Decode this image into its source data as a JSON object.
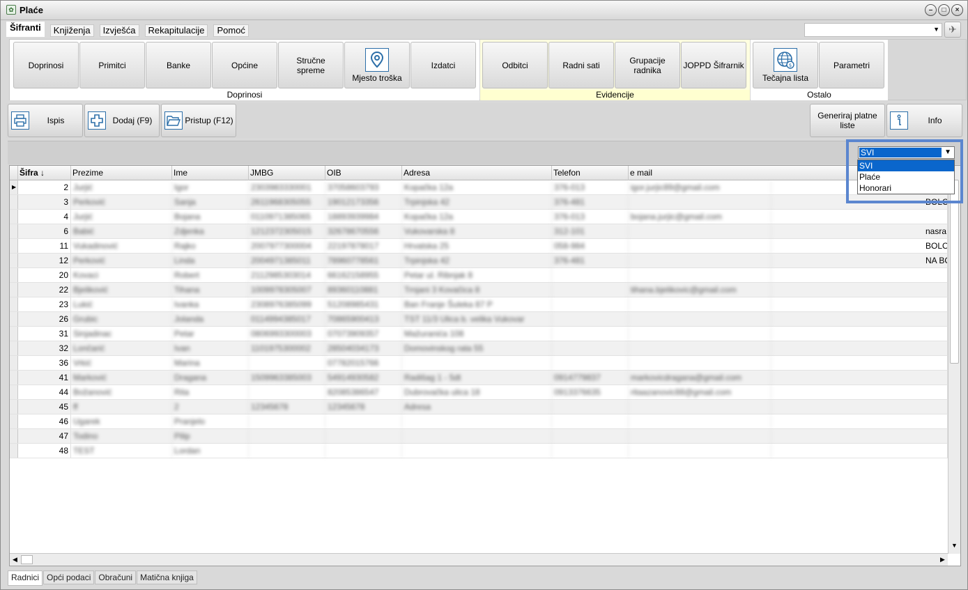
{
  "window": {
    "title": "Plaće"
  },
  "menu": {
    "tabs": [
      "Šifranti",
      "Knjiženja",
      "Izvješća",
      "Rekapitulacije",
      "Pomoć"
    ],
    "active": "Šifranti"
  },
  "ribbon": {
    "groups": [
      {
        "label": "Doprinosi",
        "buttons": [
          "Doprinosi",
          "Primitci",
          "Banke",
          "Općine",
          "Stručne spreme",
          "Mjesto troška",
          "Izdatci"
        ]
      },
      {
        "label": "Evidencije",
        "buttons": [
          "Odbitci",
          "Radni sati",
          "Grupacije radnika",
          "JOPPD Šifrarnik"
        ]
      },
      {
        "label": "Ostalo",
        "buttons": [
          "Tečajna lista",
          "Parametri"
        ]
      }
    ]
  },
  "toolbar": {
    "print": "Ispis",
    "add": "Dodaj (F9)",
    "open": "Pristup (F12)",
    "generate": "Generiraj platne liste",
    "info": "Info"
  },
  "filter": {
    "selected": "SVI",
    "options": [
      "SVI",
      "Plaće",
      "Honorari"
    ]
  },
  "grid": {
    "columns": [
      "Šifra ↓",
      "Prezime",
      "Ime",
      "JMBG",
      "OIB",
      "Adresa",
      "Telefon",
      "e mail"
    ],
    "rows": [
      {
        "sifra": "2",
        "prezime": "Jurjić",
        "ime": "Igor",
        "jmbg": "2303983330001",
        "oib": "37058603793",
        "adresa": "Kopačka 12a",
        "telefon": "376-013",
        "email": "igor.jurjic89@gmail.com",
        "note": ""
      },
      {
        "sifra": "3",
        "prezime": "Perković",
        "ime": "Sanja",
        "jmbg": "2611968305055",
        "oib": "19012173356",
        "adresa": "Trpinjska 42",
        "telefon": "376-481",
        "email": "",
        "note": "BOLO"
      },
      {
        "sifra": "4",
        "prezime": "Jurjić",
        "ime": "Bojana",
        "jmbg": "0110971385065",
        "oib": "18893939984",
        "adresa": "Kopačka 12a",
        "telefon": "376-013",
        "email": "bojana.jurjic@gmail.com",
        "note": ""
      },
      {
        "sifra": "6",
        "prezime": "Babić",
        "ime": "Zdjenka",
        "jmbg": "1212372305015",
        "oib": "32678670556",
        "adresa": "Vukovarska 8",
        "telefon": "312-101",
        "email": "",
        "note": "nasra"
      },
      {
        "sifra": "11",
        "prezime": "Vukadinović",
        "ime": "Rajko",
        "jmbg": "2007977300004",
        "oib": "22197878017",
        "adresa": "Hrvatska 25",
        "telefon": "058-984",
        "email": "",
        "note": "BOLO"
      },
      {
        "sifra": "12",
        "prezime": "Perković",
        "ime": "Linda",
        "jmbg": "2004971385011",
        "oib": "78960778561",
        "adresa": "Trpinjska 42",
        "telefon": "376-481",
        "email": "",
        "note": "NA BC"
      },
      {
        "sifra": "20",
        "prezime": "Kovaci",
        "ime": "Robert",
        "jmbg": "2112985303014",
        "oib": "66162158955",
        "adresa": "Petar ul. Ribnjak 8",
        "telefon": "",
        "email": "",
        "note": ""
      },
      {
        "sifra": "22",
        "prezime": "Bjeliković",
        "ime": "Tihana",
        "jmbg": "1009978305007",
        "oib": "89360110881",
        "adresa": "Trnjani 3 Kovačica 8",
        "telefon": "",
        "email": "tihana.bjelikovic@gmail.com",
        "note": ""
      },
      {
        "sifra": "23",
        "prezime": "Lukić",
        "ime": "Ivanka",
        "jmbg": "2308976385099",
        "oib": "51208985431",
        "adresa": "Ban Franje Šuleka 87 P",
        "telefon": "",
        "email": "",
        "note": ""
      },
      {
        "sifra": "26",
        "prezime": "Grubic",
        "ime": "Jolanda",
        "jmbg": "0114994385017",
        "oib": "70865900413",
        "adresa": "TST 11/3 Ulica b. velika Vukovar",
        "telefon": "",
        "email": "",
        "note": ""
      },
      {
        "sifra": "31",
        "prezime": "Sinjadinac",
        "ime": "Petar",
        "jmbg": "0806993300003",
        "oib": "07073909357",
        "adresa": "Mažuranića 108",
        "telefon": "",
        "email": "",
        "note": ""
      },
      {
        "sifra": "32",
        "prezime": "Lončarić",
        "ime": "Ivan",
        "jmbg": "1101975300002",
        "oib": "28504034173",
        "adresa": "Domovinskog rata 55",
        "telefon": "",
        "email": "",
        "note": ""
      },
      {
        "sifra": "36",
        "prezime": "Vrkić",
        "ime": "Marina",
        "jmbg": "",
        "oib": "07782015766",
        "adresa": "",
        "telefon": "",
        "email": "",
        "note": ""
      },
      {
        "sifra": "41",
        "prezime": "Marković",
        "ime": "Dragana",
        "jmbg": "1509963385003",
        "oib": "54914930582",
        "adresa": "Radišag 1 - 5dt",
        "telefon": "0914779837",
        "email": "markovicdragana@gmail.com",
        "note": ""
      },
      {
        "sifra": "44",
        "prezime": "Božanović",
        "ime": "Rita",
        "jmbg": "",
        "oib": "82085386547",
        "adresa": "Dubrovačka ulica 18",
        "telefon": "0913376635",
        "email": "ritaazanovic88@gmail.com",
        "note": ""
      },
      {
        "sifra": "45",
        "prezime": "ff",
        "ime": "2",
        "jmbg": "12345678",
        "oib": "12345678",
        "adresa": "Adresa",
        "telefon": "",
        "email": "",
        "note": ""
      },
      {
        "sifra": "46",
        "prezime": "Ugarek",
        "ime": "Pranjelo",
        "jmbg": "",
        "oib": "",
        "adresa": "",
        "telefon": "",
        "email": "",
        "note": ""
      },
      {
        "sifra": "47",
        "prezime": "Todino",
        "ime": "Pilip",
        "jmbg": "",
        "oib": "",
        "adresa": "",
        "telefon": "",
        "email": "",
        "note": ""
      },
      {
        "sifra": "48",
        "prezime": "TEST",
        "ime": "Lordan",
        "jmbg": "",
        "oib": "",
        "adresa": "",
        "telefon": "",
        "email": "",
        "note": ""
      }
    ]
  },
  "bottom_tabs": [
    "Radnici",
    "Opći podaci",
    "Obračuni",
    "Matična knjiga"
  ],
  "colors": {
    "accent": "#0a66cc",
    "highlight_frame": "#5b86cf",
    "evidencije_bg": "#ffffe0"
  }
}
